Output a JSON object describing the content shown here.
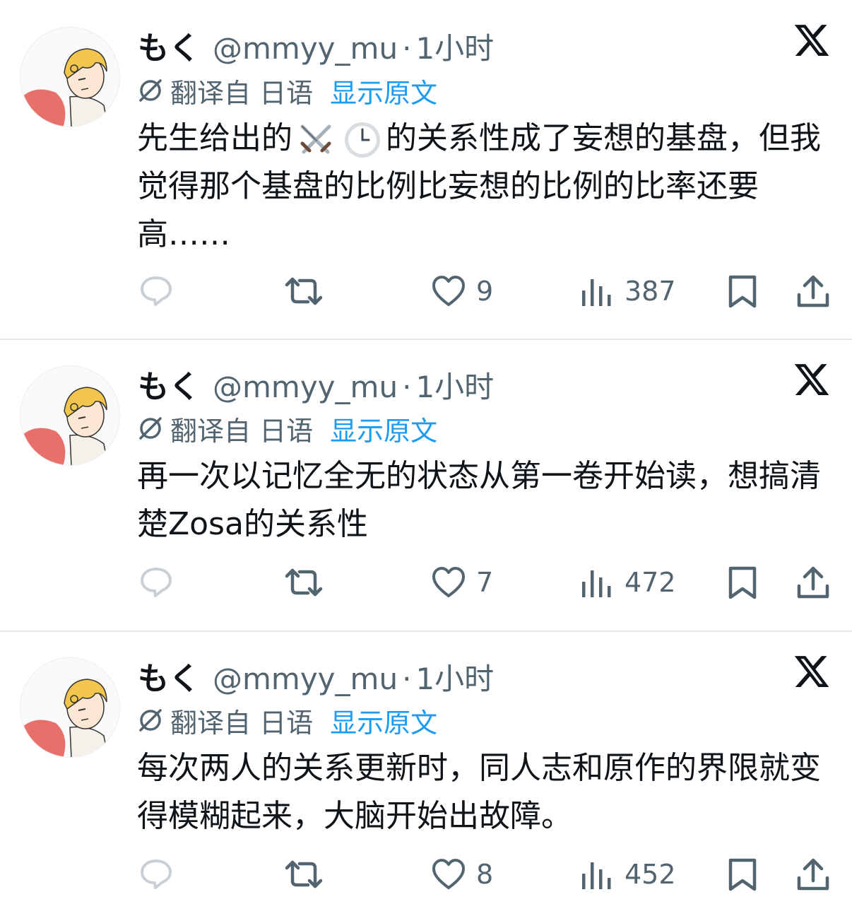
{
  "tweets": [
    {
      "author_name": "もく",
      "handle": "@mmyy_mu",
      "separator": "·",
      "time": "1小时",
      "translated_label": "翻译自 日语",
      "show_original": "显示原文",
      "text_before_emoji": "先生给出的",
      "emojis": [
        "crossed-swords",
        "clock"
      ],
      "text_after_emoji": "的关系性成了妄想的基盘，但我觉得那个基盘的比例比妄想的比例的比率还要高……",
      "likes": "9",
      "views": "387"
    },
    {
      "author_name": "もく",
      "handle": "@mmyy_mu",
      "separator": "·",
      "time": "1小时",
      "translated_label": "翻译自 日语",
      "show_original": "显示原文",
      "text": "再一次以记忆全无的状态从第一卷开始读，想搞清楚Zosa的关系性",
      "likes": "7",
      "views": "472"
    },
    {
      "author_name": "もく",
      "handle": "@mmyy_mu",
      "separator": "·",
      "time": "1小时",
      "translated_label": "翻译自 日语",
      "show_original": "显示原文",
      "text": "每次两人的关系更新时，同人志和原作的界限就变得模糊起来，大脑开始出故障。",
      "likes": "8",
      "views": "452"
    }
  ],
  "icons": {
    "reply": "reply-icon",
    "retweet": "retweet-icon",
    "like": "heart-icon",
    "views": "views-icon",
    "bookmark": "bookmark-icon",
    "share": "share-icon",
    "platform": "x-logo-icon",
    "translate": "translate-icon"
  },
  "colors": {
    "link": "#1d9bf0",
    "secondary": "#536471",
    "primary": "#0f1419",
    "divider": "#e6e9eb"
  }
}
